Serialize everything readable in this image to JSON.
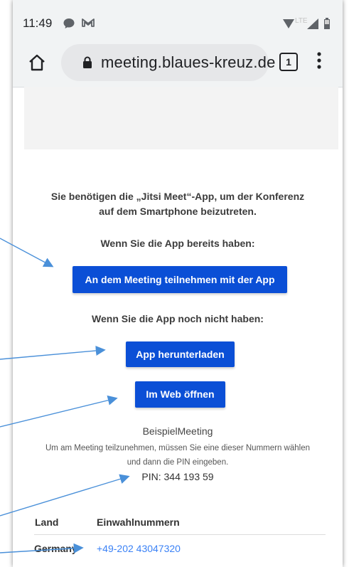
{
  "status_bar": {
    "time": "11:49",
    "network": "LTE"
  },
  "browser": {
    "url": "meeting.blaues-kreuz.de",
    "tab_count": "1"
  },
  "content": {
    "intro_line1": "Sie benötigen die „Jitsi Meet“-App, um der Konferenz",
    "intro_line2": "auf dem Smartphone beizutreten.",
    "have_app_text": "Wenn Sie die App bereits haben:",
    "join_app_button": "An dem Meeting teilnehmen mit der App",
    "no_app_text": "Wenn Sie die App noch nicht haben:",
    "download_button": "App herunterladen",
    "web_button": "Im Web öffnen",
    "meeting_name": "BeispielMeeting",
    "dial_info_line1": "Um am Meeting teilzunehmen, müssen Sie eine dieser Nummern wählen",
    "dial_info_line2": "und dann die PIN eingeben.",
    "pin_label": "PIN: 344 193 59"
  },
  "dial_table": {
    "headers": [
      "Land",
      "Einwahlnummern"
    ],
    "rows": [
      {
        "country": "Germany",
        "number": "+49-202 43047320"
      }
    ]
  },
  "colors": {
    "button_blue": "#0b4fd6",
    "link_blue": "#3b82f6",
    "arrow_blue": "#4a90d9"
  }
}
